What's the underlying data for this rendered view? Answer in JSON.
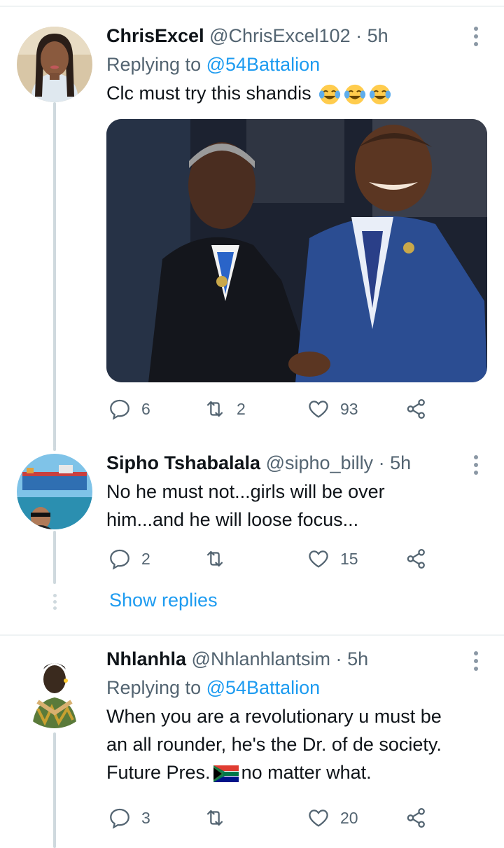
{
  "tweets": [
    {
      "name": "ChrisExcel",
      "handle": "@ChrisExcel102",
      "separator": "·",
      "time": "5h",
      "replying_prefix": "Replying to",
      "replying_handle": "@54Battalion",
      "text": "Clc must try this shandis",
      "emoji": [
        "face-with-tears-of-joy",
        "face-with-tears-of-joy",
        "face-with-tears-of-joy"
      ],
      "has_media": true,
      "replies": "6",
      "retweets": "2",
      "likes": "93"
    },
    {
      "name": "Sipho Tshabalala",
      "handle": "@sipho_billy",
      "separator": "·",
      "time": "5h",
      "text_line1": "No he must not...girls will be over",
      "text_line2": "him...and he will loose focus...",
      "replies": "2",
      "retweets": "",
      "likes": "15",
      "show_replies": "Show replies"
    },
    {
      "name": "Nhlanhla",
      "handle": "@Nhlanhlantsim",
      "separator": "·",
      "time": "5h",
      "replying_prefix": "Replying to",
      "replying_handle": "@54Battalion",
      "text_line1": "When you are a revolutionary u must be",
      "text_line2": "an all rounder, he's the Dr. of de society.",
      "text_line3_before": "Future Pres.",
      "text_line3_after": "no matter what.",
      "flag": "south-africa-flag",
      "replies": "3",
      "retweets": "",
      "likes": "20"
    }
  ],
  "colors": {
    "text": "#0f1419",
    "muted": "#536471",
    "link": "#1d9bf0",
    "thread": "#cfd9de"
  }
}
